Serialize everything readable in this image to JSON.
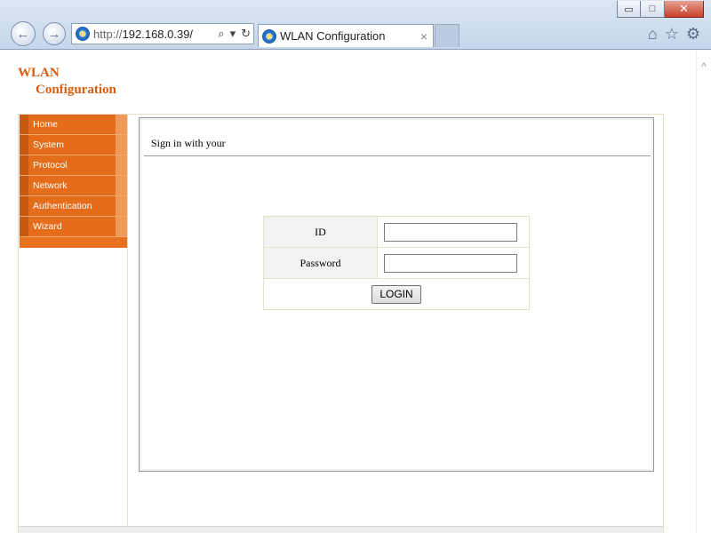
{
  "browser": {
    "url_prefix": "http://",
    "url_host": "192.168.0.39/",
    "tab_title": "WLAN Configuration",
    "tab_close": "×",
    "window_controls": {
      "minimize": "▭",
      "maximize": "□",
      "close": "✕"
    },
    "back_glyph": "←",
    "forward_glyph": "→",
    "search_glyph": "⌕",
    "dropdown_glyph": "▾",
    "refresh_glyph": "↻",
    "ie_glyph": "e",
    "home_glyph": "⌂",
    "favorites_glyph": "☆",
    "settings_glyph": "⚙",
    "scroll_up_glyph": "^"
  },
  "logo": {
    "line1": "WLAN",
    "line2": "Configuration",
    "color": "#d85c10"
  },
  "menu": {
    "accent": "#e8721e",
    "items": [
      {
        "label": "Home"
      },
      {
        "label": "System"
      },
      {
        "label": "Protocol"
      },
      {
        "label": "Network"
      },
      {
        "label": "Authentication"
      },
      {
        "label": "Wizard"
      }
    ]
  },
  "content": {
    "heading": "Sign in with your"
  },
  "login": {
    "id_label": "ID",
    "id_value": "",
    "password_label": "Password",
    "password_value": "",
    "button_label": "LOGIN"
  }
}
